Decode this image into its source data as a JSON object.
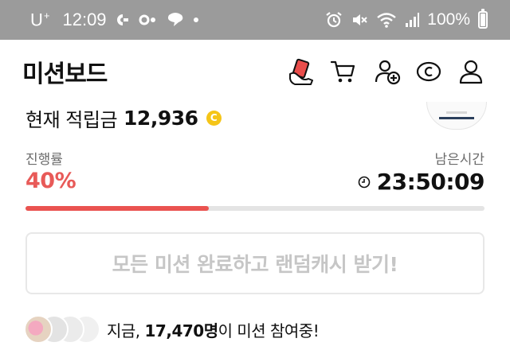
{
  "status_bar": {
    "carrier": "U",
    "carrier_sup": "+",
    "time": "12:09",
    "battery": "100%",
    "icons": [
      "pay-icon",
      "link-icon",
      "chat-icon",
      "dot-icon",
      "alarm-icon",
      "mute-icon",
      "wifi-icon",
      "signal-icon",
      "battery-icon"
    ]
  },
  "header": {
    "title": "미션보드",
    "icons": [
      "hand-card-icon",
      "cart-icon",
      "add-friend-icon",
      "coin-c-icon",
      "profile-icon"
    ]
  },
  "balance": {
    "label": "현재 적립금",
    "value": "12,936",
    "coin_symbol": "C"
  },
  "progress": {
    "label": "진행률",
    "value_text": "40%",
    "fraction": 0.4,
    "remaining_label": "남은시간",
    "remaining_time": "23:50:09"
  },
  "cta": {
    "label": "모든 미션 완료하고 랜덤캐시 받기!"
  },
  "participants": {
    "prefix": "지금, ",
    "count": "17,470명",
    "suffix": "이 미션 참여중!"
  },
  "colors": {
    "accent": "#ea5350",
    "status_bar": "#9b9b9b",
    "coin": "#f5c518",
    "cta_text_disabled": "#c6c6c6"
  }
}
